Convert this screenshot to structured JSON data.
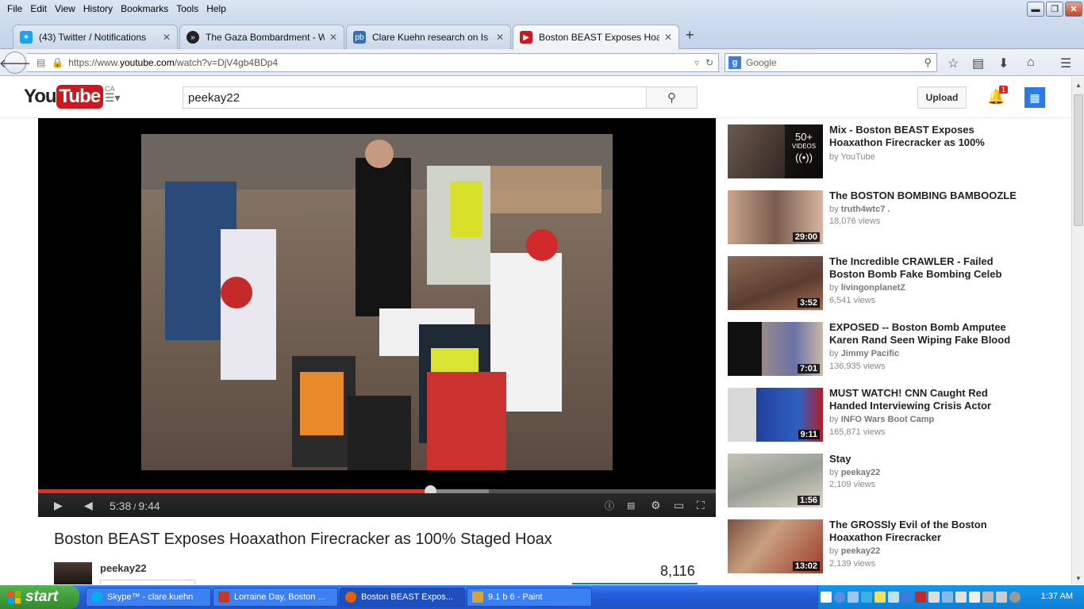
{
  "menubar": {
    "items": [
      "File",
      "Edit",
      "View",
      "History",
      "Bookmarks",
      "Tools",
      "Help"
    ],
    "access_keys": [
      "F",
      "E",
      "V",
      "H",
      "B",
      "T",
      "H"
    ]
  },
  "tabs": [
    {
      "label": "(43) Twitter / Notifications",
      "icon": "twitter-bird-icon",
      "color": "#1da1f2"
    },
    {
      "label": "The Gaza Bombardment - Wh...",
      "icon": "forward-circle-icon",
      "color": "#222222"
    },
    {
      "label": "Clare Kuehn research on Is P...",
      "icon": "pd-logo-icon",
      "color": "#3b6fb6"
    },
    {
      "label": "Boston BEAST Exposes Hoax...",
      "icon": "youtube-play-icon",
      "color": "#cc181e"
    }
  ],
  "nav": {
    "url_prefix": "https://www.",
    "url_host": "youtube.com",
    "url_path": "/watch?v=DjV4gb4BDp4",
    "search_engine_placeholder": "Google"
  },
  "youtube": {
    "logo_you": "You",
    "logo_tube": "Tube",
    "logo_region": "CA",
    "search_value": "peekay22",
    "upload_label": "Upload",
    "notification_count": "1"
  },
  "player": {
    "time_current": "5:38",
    "time_total": "9:44",
    "played_fraction": 0.579,
    "buffered_fraction": 0.665
  },
  "video": {
    "title": "Boston BEAST Exposes Hoaxathon Firecracker as 100% Staged Hoax",
    "channel": "peekay22",
    "views": "8,116"
  },
  "related": [
    {
      "title": "Mix - Boston BEAST Exposes Hoaxathon Firecracker as 100%",
      "by": "YouTube",
      "views": "",
      "duration": "",
      "mix_count": "50+",
      "mix_label": "VIDEOS"
    },
    {
      "title": "The BOSTON BOMBING BAMBOOZLE",
      "by": "truth4wtc7 .",
      "views": "18,076 views",
      "duration": "29:00"
    },
    {
      "title": "The Incredible CRAWLER - Failed Boston Bomb Fake Bombing Celeb",
      "by": "livingonplanetZ",
      "views": "6,541 views",
      "duration": "3:52"
    },
    {
      "title": "EXPOSED -- Boston Bomb Amputee Karen Rand Seen Wiping Fake Blood",
      "by": "Jimmy Pacific",
      "views": "136,935 views",
      "duration": "7:01"
    },
    {
      "title": "MUST WATCH! CNN Caught Red Handed Interviewing Crisis Actor",
      "by": "INFO Wars Boot Camp",
      "views": "165,871 views",
      "duration": "9:11"
    },
    {
      "title": "Stay",
      "by": "peekay22",
      "views": "2,109 views",
      "duration": "1:56"
    },
    {
      "title": "The GROSSly Evil of the Boston Hoaxathon Firecracker",
      "by": "peekay22",
      "views": "2,139 views",
      "duration": "13:02"
    }
  ],
  "by_prefix": "by ",
  "taskbar": {
    "start_label": "start",
    "items": [
      {
        "label": "Skype™ - clare.kuehn",
        "color": "#00aff0"
      },
      {
        "label": "Lorraine Day, Boston ...",
        "color": "#c0392b"
      },
      {
        "label": "Boston BEAST Expos...",
        "color": "#e66000"
      },
      {
        "label": "9.1 b 6 - Paint",
        "color": "#d4a437"
      }
    ],
    "clock": "1:37 AM"
  }
}
